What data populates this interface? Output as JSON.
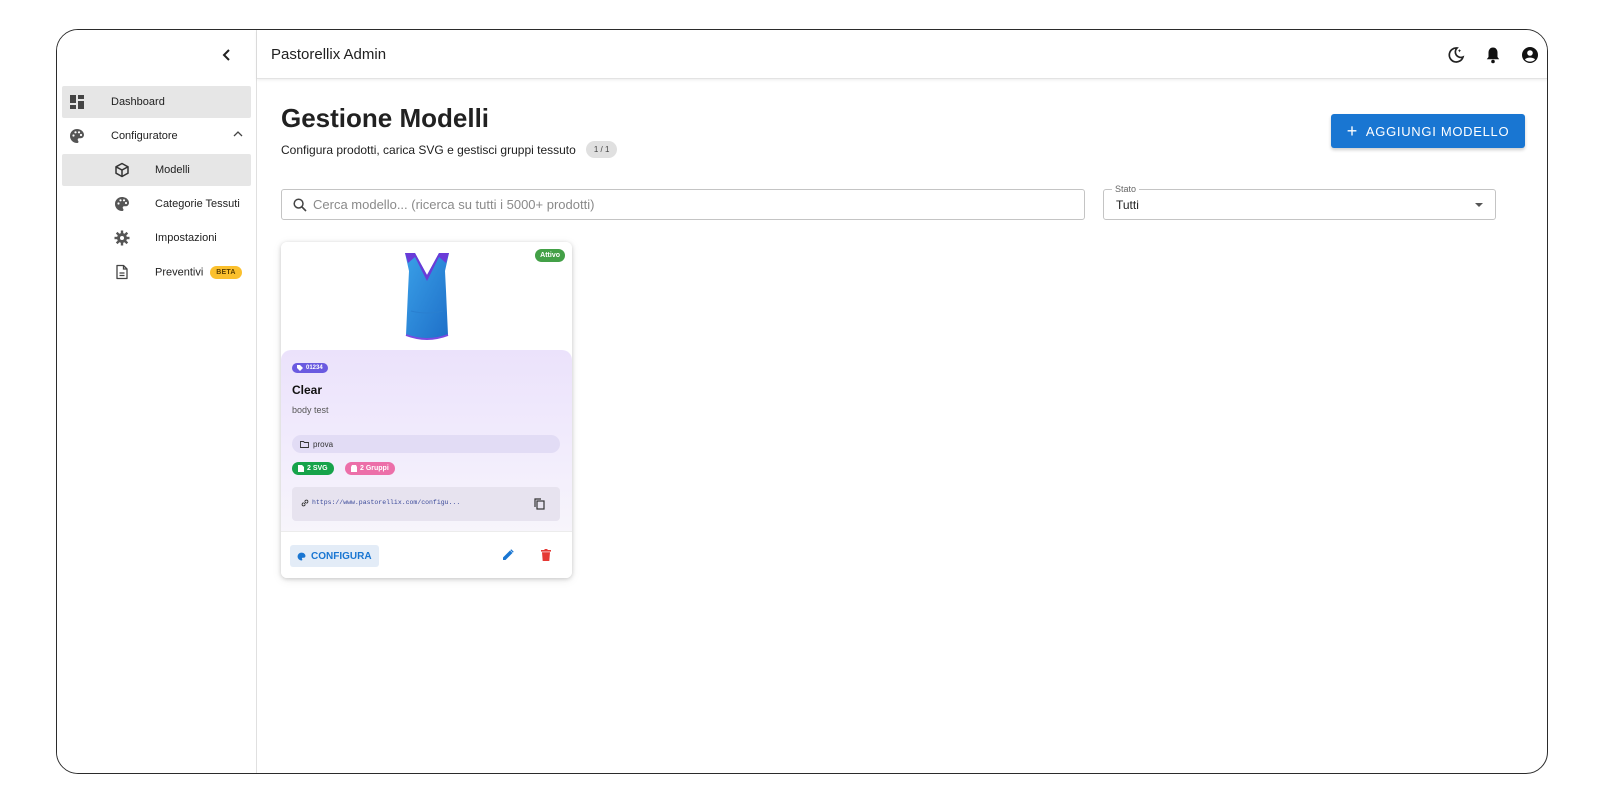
{
  "app": {
    "title": "Pastorellix Admin"
  },
  "sidebar": {
    "items": [
      {
        "label": "Dashboard",
        "icon": "dashboard-icon",
        "active": true
      },
      {
        "label": "Configuratore",
        "icon": "palette-icon",
        "expanded": true
      },
      {
        "label": "Modelli",
        "icon": "cube-icon",
        "active": true
      },
      {
        "label": "Categorie Tessuti",
        "icon": "palette-icon"
      },
      {
        "label": "Impostazioni",
        "icon": "gear-icon"
      },
      {
        "label": "Preventivi",
        "icon": "document-icon",
        "badge": "BETA"
      }
    ]
  },
  "header": {
    "title": "Gestione Modelli",
    "subtitle": "Configura prodotti, carica SVG e gestisci gruppi tessuto",
    "count": "1 / 1"
  },
  "actions": {
    "add_label": "AGGIUNGI MODELLO"
  },
  "search": {
    "placeholder": "Cerca modello... (ricerca su tutti i 5000+ prodotti)",
    "value": ""
  },
  "filter": {
    "label": "Stato",
    "value": "Tutti"
  },
  "models": [
    {
      "status": "Attivo",
      "code": "01234",
      "name": "Clear",
      "description": "body test",
      "category": "prova",
      "svg_count": "2 SVG",
      "groups_count": "2 Gruppi",
      "url": "https://www.pastorellix.com/configu...",
      "configure_label": "CONFIGURA"
    }
  ],
  "colors": {
    "primary": "#1976d2",
    "active_status": "#43a047",
    "code_chip": "#6a5ae0",
    "svg_chip": "#16a34a",
    "group_chip": "#ec6fa9",
    "delete": "#e53935",
    "beta": "#fbc02d"
  }
}
